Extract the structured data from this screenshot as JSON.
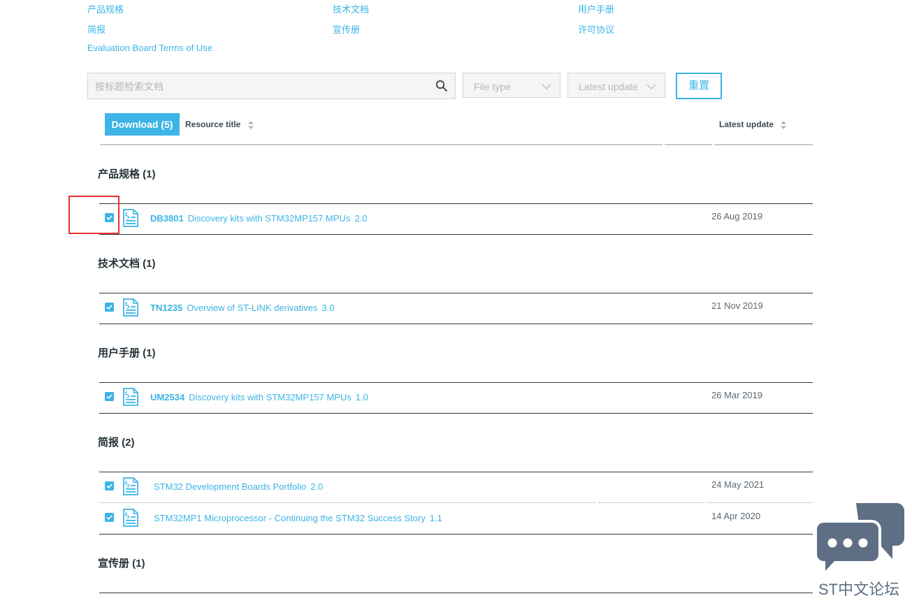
{
  "top_links": [
    {
      "label": "产品规格"
    },
    {
      "label": "技术文档"
    },
    {
      "label": "用户手册"
    },
    {
      "label": "简报"
    },
    {
      "label": "宣传册"
    },
    {
      "label": "许可协议"
    },
    {
      "label": "Evaluation Board Terms of Use"
    }
  ],
  "filters": {
    "search_placeholder": "按标题检索文档",
    "search_icon": "search-icon",
    "file_type_label": "File type",
    "latest_update_label": "Latest update",
    "reset_label": "重置"
  },
  "table": {
    "download_label": "Download (5)",
    "col_title": "Resource title",
    "col_date": "Latest update"
  },
  "sections": [
    {
      "heading": "产品规格 (1)",
      "docs": [
        {
          "code": "DB3801",
          "title": "Discovery kits with STM32MP157 MPUs",
          "version": "2.0",
          "date": "26 Aug 2019",
          "checked": true
        }
      ]
    },
    {
      "heading": "技术文档 (1)",
      "docs": [
        {
          "code": "TN1235",
          "title": "Overview of ST-LINK derivatives",
          "version": "3.0",
          "date": "21 Nov 2019",
          "checked": true
        }
      ]
    },
    {
      "heading": "用户手册 (1)",
      "docs": [
        {
          "code": "UM2534",
          "title": "Discovery kits with STM32MP157 MPUs",
          "version": "1.0",
          "date": "26 Mar 2019",
          "checked": true
        }
      ]
    },
    {
      "heading": "简报 (2)",
      "docs": [
        {
          "code": "",
          "title": "STM32 Development Boards Portfolio",
          "version": "2.0",
          "date": "24 May 2021",
          "checked": true
        },
        {
          "code": "",
          "title": "STM32MP1 Microprocessor - Continuing the STM32 Success Story",
          "version": "1.1",
          "date": "14 Apr 2020",
          "checked": true
        }
      ]
    },
    {
      "heading": "宣传册 (1)",
      "docs": []
    }
  ],
  "watermark": {
    "text": "ST中文论坛",
    "icon": "chat-bubble-icon",
    "color": "#5e6f85"
  },
  "colors": {
    "accent": "#3cb4e6",
    "highlight": "#e8332e"
  }
}
